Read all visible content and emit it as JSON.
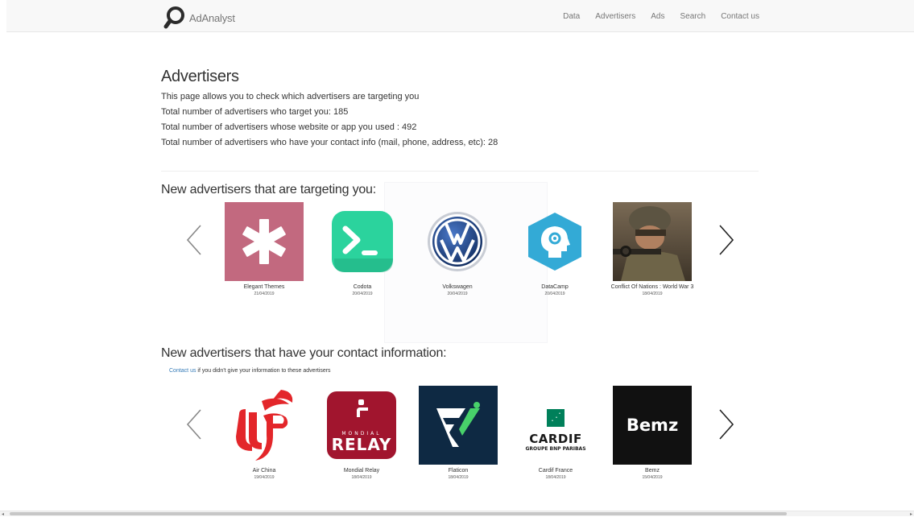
{
  "navbar": {
    "brand": "AdAnalyst",
    "links": [
      "Data",
      "Advertisers",
      "Ads",
      "Search",
      "Contact us"
    ]
  },
  "header": {
    "title": "Advertisers",
    "description": "This page allows you to check which advertisers are targeting you",
    "stat_targeting": "Total number of advertisers who target you: 185",
    "stat_website": "Total number of advertisers whose website or app you used : 492",
    "stat_contact": "Total number of advertisers who have your contact info (mail, phone, address, etc): 28"
  },
  "targeting": {
    "title": "New advertisers that are targeting you:",
    "items": [
      {
        "name": "Elegant Themes",
        "date": "21/04/2019"
      },
      {
        "name": "Codota",
        "date": "20/04/2019"
      },
      {
        "name": "Volkswagen",
        "date": "20/04/2019"
      },
      {
        "name": "DataCamp",
        "date": "20/04/2019"
      },
      {
        "name": "Conflict Of Nations : World War 3",
        "date": "18/04/2019"
      }
    ]
  },
  "contact": {
    "title": "New advertisers that have your contact information:",
    "note_link": "Contact us",
    "note_text": " if you didn't give your information to these advertisers",
    "items": [
      {
        "name": "Air China",
        "date": "19/04/2019"
      },
      {
        "name": "Mondial Relay",
        "date": "18/04/2019"
      },
      {
        "name": "Flaticon",
        "date": "18/04/2019"
      },
      {
        "name": "Cardif France",
        "date": "18/04/2019"
      },
      {
        "name": "Bemz",
        "date": "15/04/2019"
      }
    ]
  },
  "logo_text": {
    "mondial_top": "MONDIAL",
    "mondial_main": "RELAY",
    "cardif_main": "CARDIF",
    "cardif_sub": "GROUPE BNP PARIBAS",
    "bemz": "Bemz"
  },
  "colors": {
    "elegant": "#c2697f",
    "codota": "#2bd39d",
    "volkswagen": "#1f3f7a",
    "datacamp": "#33aad6",
    "airchina": "#e3262a",
    "mondial": "#a1152e",
    "flaticon": "#0e2943",
    "flaticon_accent": "#48d06a",
    "cardif": "#00805a",
    "bemz": "#111111",
    "link": "#337ab7"
  }
}
